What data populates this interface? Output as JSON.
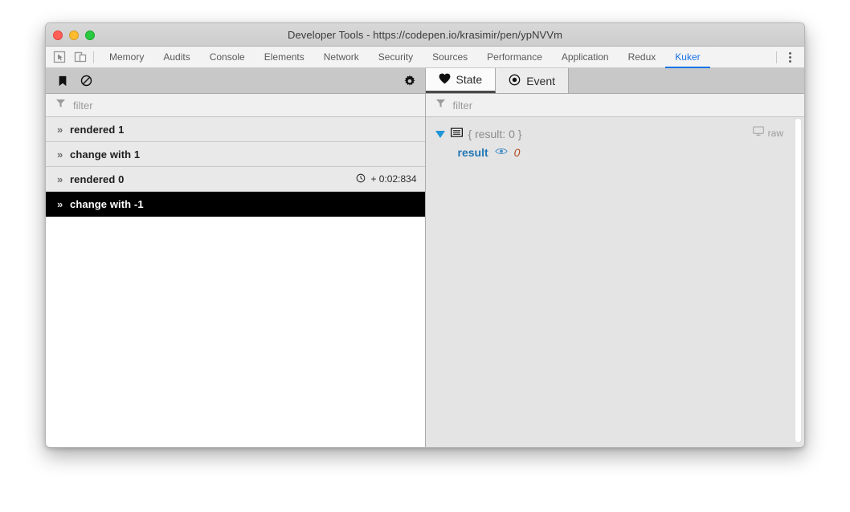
{
  "window": {
    "title": "Developer Tools - https://codepen.io/krasimir/pen/ypNVVm",
    "traffic_lights": [
      "close",
      "minimize",
      "zoom"
    ]
  },
  "devtools": {
    "left_icons": [
      "inspect-element-icon",
      "device-toolbar-icon"
    ],
    "tabs": [
      {
        "label": "Memory",
        "active": false
      },
      {
        "label": "Audits",
        "active": false
      },
      {
        "label": "Console",
        "active": false
      },
      {
        "label": "Elements",
        "active": false
      },
      {
        "label": "Network",
        "active": false
      },
      {
        "label": "Security",
        "active": false
      },
      {
        "label": "Sources",
        "active": false
      },
      {
        "label": "Performance",
        "active": false
      },
      {
        "label": "Application",
        "active": false
      },
      {
        "label": "Redux",
        "active": false
      },
      {
        "label": "Kuker",
        "active": true
      }
    ],
    "overflow_menu": "more-options-icon",
    "accent_color": "#1a73e8"
  },
  "left_panel": {
    "toolbar": {
      "bookmark_label": "bookmark-icon",
      "clear_label": "clear-icon",
      "settings_label": "gear-icon"
    },
    "filter": {
      "placeholder": "filter",
      "value": ""
    },
    "rows": [
      {
        "chevron": "»",
        "label": "rendered 1",
        "time": "",
        "selected": false
      },
      {
        "chevron": "»",
        "label": "change with 1",
        "time": "",
        "selected": false
      },
      {
        "chevron": "»",
        "label": "rendered 0",
        "time": "+ 0:02:834",
        "selected": false
      },
      {
        "chevron": "»",
        "label": "change with -1",
        "time": "",
        "selected": true
      }
    ]
  },
  "right_panel": {
    "tabs": [
      {
        "label": "State",
        "icon": "heart-icon",
        "active": true
      },
      {
        "label": "Event",
        "icon": "record-icon",
        "active": false
      }
    ],
    "filter": {
      "placeholder": "filter",
      "value": ""
    },
    "tree": {
      "summary": "{ result: 0 }",
      "raw_label": "raw",
      "property_key": "result",
      "property_value": "0"
    },
    "colors": {
      "key": "#2277b5",
      "value": "#b34a20",
      "triangle": "#2196d6",
      "selected_row_bg": "#000000"
    }
  }
}
